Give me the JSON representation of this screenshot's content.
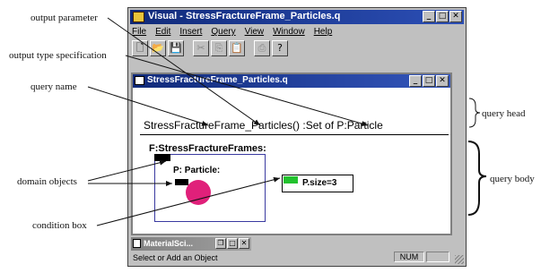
{
  "annotations": {
    "output_parameter": "output parameter",
    "output_type_spec": "output type specification",
    "query_name": "query name",
    "domain_objects": "domain objects",
    "condition_box": "condition box",
    "query_head": "query head",
    "query_body": "query body"
  },
  "window": {
    "title": "Visual - StressFractureFrame_Particles.q",
    "menu": [
      "File",
      "Edit",
      "Insert",
      "Query",
      "View",
      "Window",
      "Help"
    ],
    "toolbar_icons": [
      "new-icon",
      "open-icon",
      "save-icon",
      "cut-icon",
      "copy-icon",
      "paste-icon",
      "print-icon",
      "help-icon"
    ]
  },
  "query_window": {
    "title": "StressFractureFrame_Particles.q",
    "head_text": "StressFractureFrame_Particles() :Set of P:Particle",
    "outer_object": "F:StressFractureFrames:",
    "inner_object": "P: Particle:",
    "condition": "P.size=3"
  },
  "minimized_window": {
    "title": "MaterialSci..."
  },
  "status": {
    "text": "Select or Add an Object",
    "num": "NUM"
  },
  "colors": {
    "title_bar": "#102a7a",
    "domain_box_border": "#3a3aa0",
    "particle_blob": "#e0207a",
    "condition_flag": "#22c22e"
  }
}
